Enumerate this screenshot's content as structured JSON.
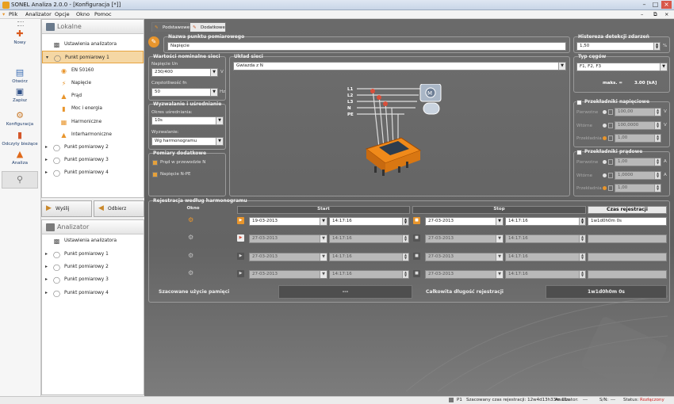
{
  "window": {
    "title": "SONEL Analiza 2.0.0 - [Konfiguracja [*]]"
  },
  "menu": [
    "Plik",
    "Analizator",
    "Opcje",
    "Okno",
    "Pomoc"
  ],
  "toolbar": [
    {
      "label": "Nowy",
      "icon": "new-icon"
    },
    {
      "label": "Otwórz",
      "icon": "open-icon"
    },
    {
      "label": "Zapisz",
      "icon": "save-icon"
    },
    {
      "label": "Konfiguracja",
      "icon": "config-icon"
    },
    {
      "label": "Odczyty bieżące",
      "icon": "readings-icon"
    },
    {
      "label": "Analiza",
      "icon": "analysis-icon"
    },
    {
      "label": "",
      "icon": "tools-icon"
    }
  ],
  "lokalne": {
    "title": "Lokalne",
    "items": [
      {
        "label": "Ustawienia analizatora"
      },
      {
        "label": "Punkt pomiarowy 1"
      },
      {
        "label": "EN 50160"
      },
      {
        "label": "Napięcie"
      },
      {
        "label": "Prąd"
      },
      {
        "label": "Moc i energia"
      },
      {
        "label": "Harmoniczne"
      },
      {
        "label": "Interharmoniczne"
      },
      {
        "label": "Punkt pomiarowy 2"
      },
      {
        "label": "Punkt pomiarowy 3"
      },
      {
        "label": "Punkt pomiarowy 4"
      }
    ]
  },
  "buttons": {
    "send": "Wyślij",
    "receive": "Odbierz"
  },
  "analizator": {
    "title": "Analizator",
    "items": [
      {
        "label": "Ustawienia analizatora"
      },
      {
        "label": "Punkt pomiarowy 1"
      },
      {
        "label": "Punkt pomiarowy 2"
      },
      {
        "label": "Punkt pomiarowy 3"
      },
      {
        "label": "Punkt pomiarowy 4"
      }
    ]
  },
  "tabs": [
    "Podstawowe",
    "Dodatkowe"
  ],
  "point_name": {
    "label": "Nazwa punktu pomiarowego",
    "value": "Napięcie"
  },
  "hysteresis": {
    "label": "Histereza detekcji zdarzeń",
    "value": "1,50",
    "unit": "%"
  },
  "nominal": {
    "title": "Wartości nominalne sieci",
    "voltage_label": "Napięcie Un",
    "voltage_value": "230/400",
    "voltage_unit": "V",
    "freq_label": "Częstotliwość fn",
    "freq_value": "50",
    "freq_unit": "Hz"
  },
  "network": {
    "title": "Układ sieci",
    "value": "Gwiazda z N",
    "lines": [
      "L1",
      "L2",
      "L3",
      "N",
      "PE"
    ]
  },
  "clamps": {
    "title": "Typ cęgów",
    "value": "F1, F2, F3",
    "max_label": "maks. =",
    "max_value": "3.00 [kA]"
  },
  "averaging": {
    "title": "Wyzwalanie i uśrednianie",
    "period_label": "Okres uśredniania:",
    "period_value": "10s",
    "trigger_label": "Wyzwalanie:",
    "trigger_value": "Wg harmonogramu"
  },
  "additional": {
    "title": "Pomiary dodatkowe",
    "items": [
      "Prąd w przewodzie N",
      "Napięcie N-PE"
    ]
  },
  "vt": {
    "title": "Przekładniki napięciowe",
    "rows": [
      {
        "label": "Pierwotne",
        "value": "100,00",
        "unit": "V"
      },
      {
        "label": "Wtórne",
        "value": "100,0000",
        "unit": "V"
      },
      {
        "label": "Przekładnia",
        "value": "1,00",
        "unit": ""
      }
    ]
  },
  "ct": {
    "title": "Przekładniki prądowe",
    "rows": [
      {
        "label": "Pierwotne",
        "value": "1,00",
        "unit": "A"
      },
      {
        "label": "Wtórne",
        "value": "1,0000",
        "unit": "A"
      },
      {
        "label": "Przekładnia",
        "value": "1,00",
        "unit": ""
      }
    ]
  },
  "schedule": {
    "title": "Rejestracja według harmonogramu",
    "headers": {
      "window": "Okno",
      "start": "Start",
      "stop": "Stop",
      "time": "Czas rejestracji"
    },
    "rows": [
      {
        "start_date": "19-03-2013",
        "start_time": "14:17:16",
        "stop_date": "27-03-2013",
        "stop_time": "14:17:16",
        "duration": "1w1d0h0m 0s"
      },
      {
        "start_date": "27-03-2013",
        "start_time": "14:17:16",
        "stop_date": "27-03-2013",
        "stop_time": "14:17:16",
        "duration": ""
      },
      {
        "start_date": "27-03-2013",
        "start_time": "14:17:16",
        "stop_date": "27-03-2013",
        "stop_time": "14:17:16",
        "duration": ""
      },
      {
        "start_date": "27-03-2013",
        "start_time": "14:17:16",
        "stop_date": "27-03-2013",
        "stop_time": "14:17:16",
        "duration": ""
      }
    ],
    "memory_label": "Szacowane użycie pamięci",
    "memory_value": "---",
    "total_label": "Całkowita długość rejestracji",
    "total_value": "1w1d0h0m 0s"
  },
  "status": {
    "point": "P1",
    "est_time": "Szacowany czas rejestracji: 12w4d13h33m 11s",
    "analyzer_label": "Analizator:",
    "analyzer_value": "---",
    "sn_label": "S/N:",
    "sn_value": "---",
    "status_label": "Status:",
    "status_value": "Rozłączony"
  },
  "colors": {
    "accent": "#e8952c",
    "selection": "#f5d7a4",
    "panel": "#666666",
    "status_disconnected": "#d22020"
  }
}
